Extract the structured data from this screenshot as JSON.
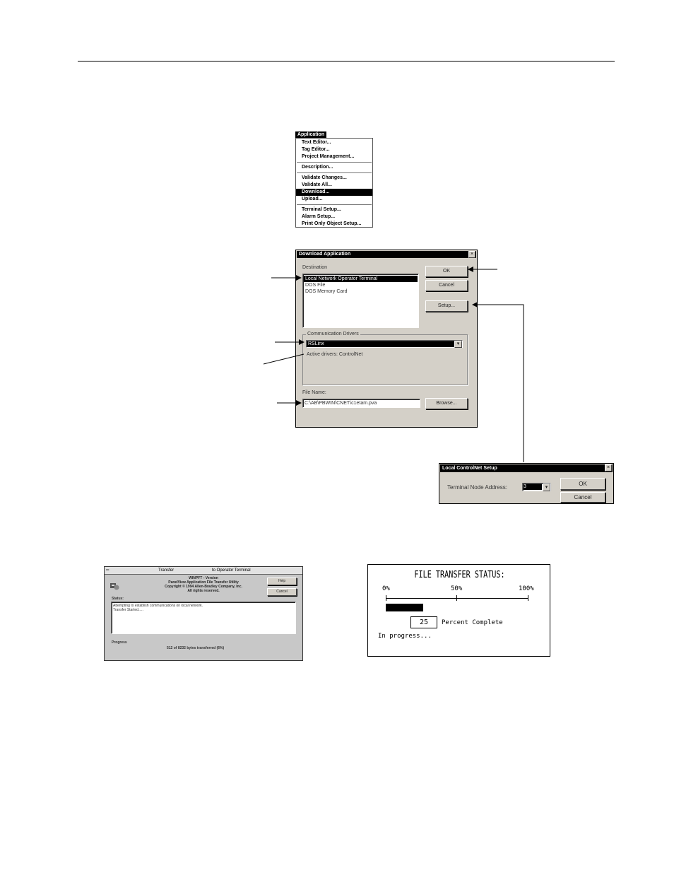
{
  "menu": {
    "title": "Application",
    "items": [
      {
        "label": "Text Editor..."
      },
      {
        "label": "Tag Editor..."
      },
      {
        "label": "Project Management..."
      },
      {
        "label": "Description..."
      },
      {
        "label": "Validate Changes..."
      },
      {
        "label": "Validate All..."
      },
      {
        "label": "Download...",
        "selected": true
      },
      {
        "label": "Upload..."
      },
      {
        "label": "Terminal Setup..."
      },
      {
        "label": "Alarm Setup..."
      },
      {
        "label": "Print Only Object Setup..."
      }
    ]
  },
  "download_dialog": {
    "title": "Download Application",
    "close": "×",
    "destination_label": "Destination",
    "destinations": [
      {
        "label": "Local Network Operator Terminal",
        "selected": true
      },
      {
        "label": "DOS File"
      },
      {
        "label": "DOS Memory Card"
      }
    ],
    "ok": "OK",
    "cancel": "Cancel",
    "setup": "Setup...",
    "drivers_group": "Communication Drivers",
    "driver_value": "RSLinx",
    "dropdown_arrow": "▾",
    "active_drivers": "Active drivers: ControlNet",
    "filename_label": "File Name:",
    "filename_value": "C:\\AB\\PBWIN\\CNET\\c1etam.pva",
    "browse": "Browse..."
  },
  "setup_dialog": {
    "title": "Local ControlNet Setup",
    "close": "×",
    "node_label": "Terminal Node Address:",
    "node_value": "3",
    "dropdown_arrow": "▾",
    "ok": "OK",
    "cancel": "Cancel"
  },
  "transfer_window": {
    "sys_menu": "═",
    "title_left": "Transfer",
    "title_right": "to Operator Terminal",
    "app_name": "WINPFT - Version",
    "app_desc": "PanelView Application File Transfer Utility",
    "copyright": "Copyright © 1994 Allen-Bradley Company, Inc.",
    "rights": "All rights reserved.",
    "help": "Help",
    "cancel": "Cancel",
    "status_label": "Status:",
    "status_line1": "Attempting to establish communications on local network.",
    "status_line2": "Transfer Started.....",
    "progress_label": "Progress",
    "progress_text": "512 of 8232 bytes transferred (6%)"
  },
  "file_transfer_status": {
    "title": "FILE TRANSFER STATUS:",
    "scale_0": "0%",
    "scale_50": "50%",
    "scale_100": "100%",
    "percent_value": "25",
    "percent_label": "Percent Complete",
    "progress_fraction": 0.25,
    "status": "In progress..."
  }
}
